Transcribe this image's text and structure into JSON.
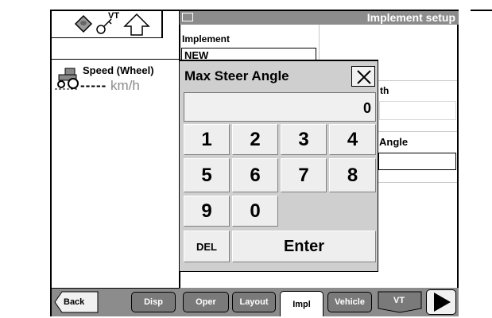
{
  "pane": {
    "title": "Implement setup"
  },
  "left_panel": {
    "icons": [
      "tractor-card-icon",
      "search-key-icon",
      "up-arrow-icon"
    ],
    "vt_badge": "VT",
    "speed_label": "Speed (Wheel)",
    "speed_value": "-----",
    "speed_unit": "km/h"
  },
  "implement_form": {
    "implement_label": "Implement",
    "implement_value": "NEW",
    "width_label_partial": "th",
    "angle_label_partial": "Angle"
  },
  "keypad": {
    "title": "Max Steer Angle",
    "display_value": "0",
    "keys": [
      "1",
      "2",
      "3",
      "4",
      "5",
      "6",
      "7",
      "8",
      "9",
      "0"
    ],
    "del_label": "DEL",
    "enter_label": "Enter"
  },
  "bottom_tabs": {
    "back": "Back",
    "disp": "Disp",
    "oper": "Oper",
    "layout": "Layout",
    "impl": "Impl",
    "vehicle": "Vehicle",
    "vt": "VT",
    "active_tab": "Impl"
  },
  "colors": {
    "title_bar": "#8c8c8c",
    "dialog_bg": "#cfcfcf",
    "unit_gray": "#8a8a8a"
  }
}
